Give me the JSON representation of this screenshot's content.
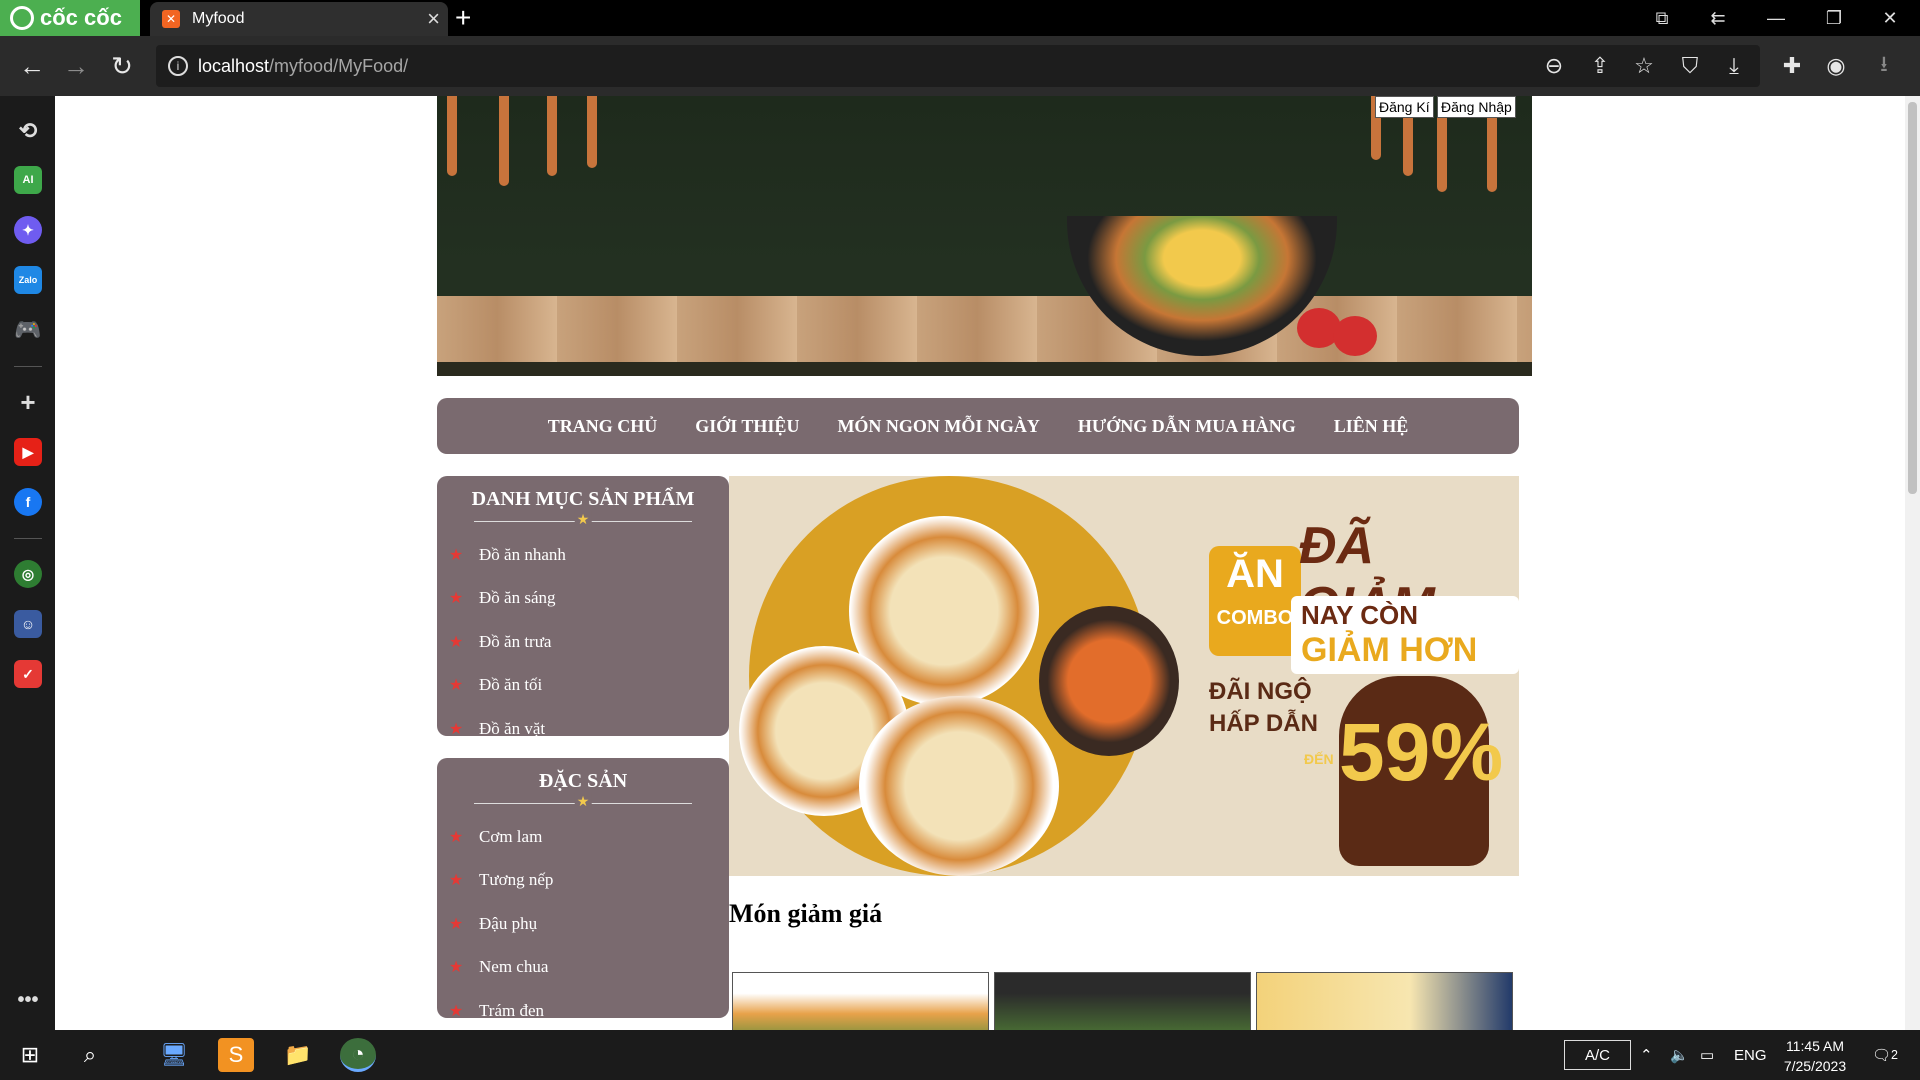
{
  "browser": {
    "brand": "cốc cốc",
    "tab_title": "Myfood",
    "tab_favicon": "xampp",
    "url_host": "localhost",
    "url_path": "/myfood/MyFood/",
    "icons": [
      "history-icon",
      "ai-icon",
      "messenger-icon",
      "zalo-icon",
      "game-icon",
      "add-icon",
      "youtube-icon",
      "facebook-icon",
      "maps-icon",
      "game-avatar-icon",
      "todo-icon",
      "more-icon"
    ]
  },
  "header": {
    "register_label": "Đăng Kí",
    "login_label": "Đăng Nhập"
  },
  "nav": {
    "items": [
      "TRANG CHỦ",
      "GIỚI THIỆU",
      "MÓN NGON MỖI NGÀY",
      "HƯỚNG DẪN MUA HÀNG",
      "LIÊN HỆ"
    ]
  },
  "categories": {
    "title": "DANH MỤC SẢN PHẨM",
    "items": [
      "Đồ ăn nhanh",
      "Đồ ăn sáng",
      "Đồ ăn trưa",
      "Đồ ăn tối",
      "Đồ ăn vặt"
    ]
  },
  "specialties": {
    "title": "ĐẶC SẢN",
    "items": [
      "Cơm lam",
      "Tương nếp",
      "Đậu phụ",
      "Nem chua",
      "Trám đen"
    ]
  },
  "promo": {
    "combo_top": "ĂN",
    "combo_bottom": "COMBO",
    "headline": "ĐÃ GIẢM",
    "sub_prefix": "NAY CÒN",
    "sub_emph": "GIẢM HƠN",
    "deal_line1": "ĐÃI NGỘ",
    "deal_line2": "HẤP DẪN",
    "den": "ĐẾN",
    "percent": "59%"
  },
  "section": {
    "title": "Món giảm giá"
  },
  "taskbar": {
    "keyboard_mode": "A/C",
    "language": "ENG",
    "time": "11:45 AM",
    "date": "7/25/2023",
    "notifications": "2"
  },
  "colors": {
    "nav_bg": "#7a6a6f",
    "browser_brand": "#4caf50",
    "accent_gold": "#e9a91e"
  }
}
